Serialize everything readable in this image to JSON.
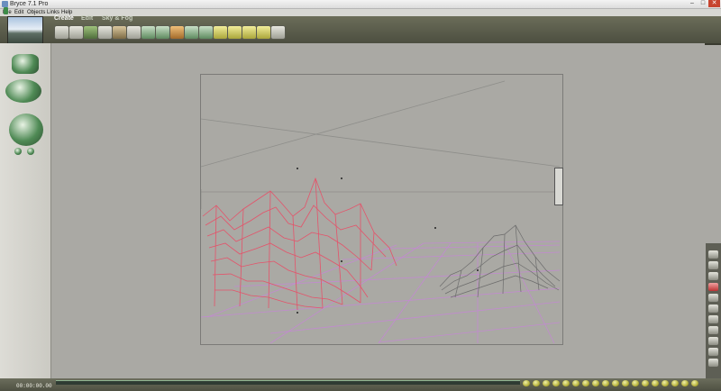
{
  "window": {
    "title": "Bryce 7.1 Pro"
  },
  "menu": {
    "items": [
      "File",
      "Edit",
      "Objects",
      "Links",
      "Help"
    ]
  },
  "palette": {
    "tabs": [
      "Create",
      "Edit",
      "Sky & Fog"
    ],
    "active": "Create"
  },
  "status": {
    "timecode": "00:00:00.00"
  },
  "colors": {
    "terrain_selected": "#e4536a",
    "terrain": "#6c6c6c",
    "ground_grid": "#c28ad0"
  }
}
